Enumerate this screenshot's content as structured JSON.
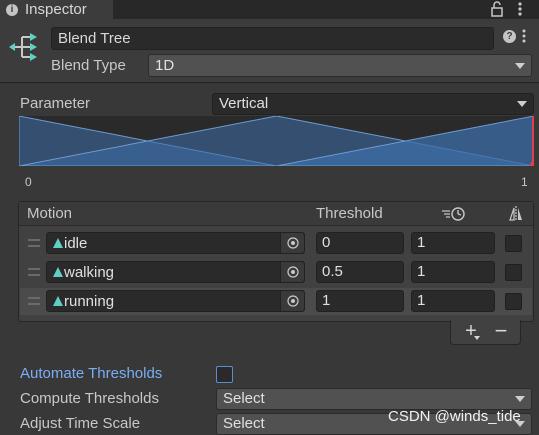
{
  "window": {
    "tab_title": "Inspector"
  },
  "header": {
    "name": "Blend Tree",
    "blend_type_label": "Blend Type",
    "blend_type_value": "1D"
  },
  "parameter": {
    "label": "Parameter",
    "value": "Vertical"
  },
  "graph": {
    "min_label": "0",
    "max_label": "1"
  },
  "chart_data": {
    "type": "area",
    "xlim": [
      0,
      1
    ],
    "series": [
      {
        "x": [
          0,
          0.5
        ],
        "values": [
          1,
          0
        ]
      },
      {
        "x": [
          0,
          0.5,
          1
        ],
        "values": [
          0,
          1,
          0
        ]
      },
      {
        "x": [
          0.5,
          1
        ],
        "values": [
          0,
          1
        ]
      }
    ],
    "highlight_x": 1
  },
  "motion_list": {
    "headers": {
      "motion": "Motion",
      "threshold": "Threshold"
    },
    "rows": [
      {
        "clip": "idle",
        "threshold": "0",
        "time_scale": "1",
        "mirror": false
      },
      {
        "clip": "walking",
        "threshold": "0.5",
        "time_scale": "1",
        "mirror": false
      },
      {
        "clip": "running",
        "threshold": "1",
        "time_scale": "1",
        "mirror": false
      }
    ],
    "add_label": "+",
    "remove_label": "−"
  },
  "settings": {
    "automate_label": "Automate Thresholds",
    "automate_checked": false,
    "compute_label": "Compute Thresholds",
    "compute_value": "Select",
    "adjust_label": "Adjust Time Scale",
    "adjust_value": "Select"
  },
  "watermark": "CSDN @winds_tide",
  "colors": {
    "accent_blue": "#3d6ea8",
    "link_blue": "#7aaef5",
    "clip_icon_teal": "#5fd1c2",
    "marker_red": "#e0404a"
  }
}
